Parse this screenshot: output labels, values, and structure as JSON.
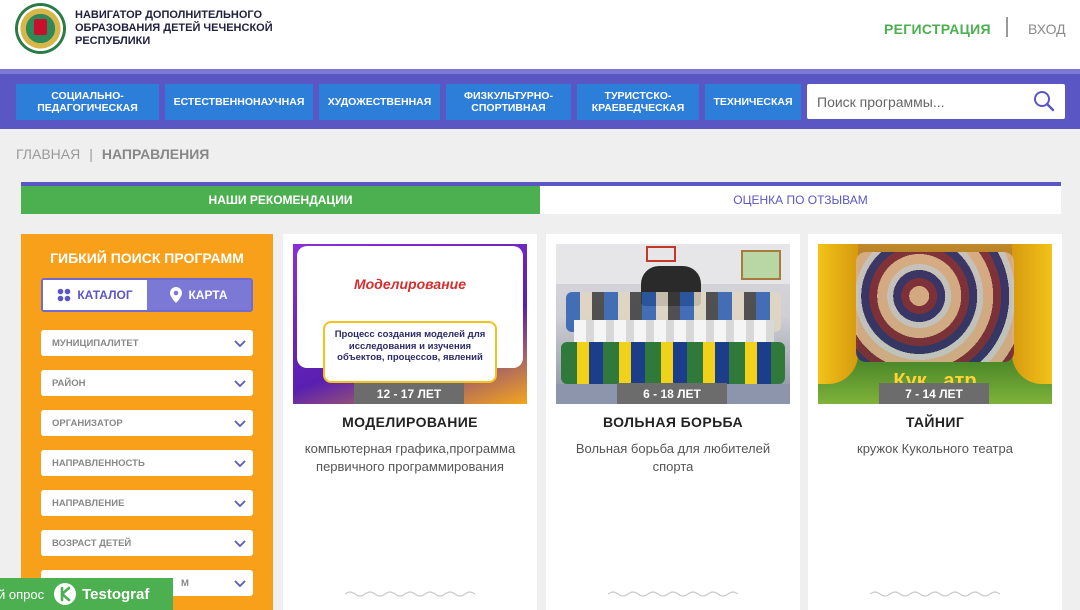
{
  "header": {
    "brand_lines": [
      "НАВИГАТОР ДОПОЛНИТЕЛЬНОГО",
      "ОБРАЗОВАНИЯ ДЕТЕЙ ЧЕЧЕНСКОЙ",
      "РЕСПУБЛИКИ"
    ],
    "register_label": "РЕГИСТРАЦИЯ",
    "login_label": "ВХОД"
  },
  "nav": {
    "items": [
      {
        "label": "СОЦИАЛЬНО-ПЕДАГОГИЧЕСКАЯ"
      },
      {
        "label": "ЕСТЕСТВЕННОНАУЧНАЯ"
      },
      {
        "label": "ХУДОЖЕСТВЕННАЯ"
      },
      {
        "label": "ФИЗКУЛЬТУРНО-СПОРТИВНАЯ"
      },
      {
        "label": "ТУРИСТСКО-КРАЕВЕДЧЕСКАЯ"
      },
      {
        "label": "ТЕХНИЧЕСКАЯ"
      }
    ],
    "search_placeholder": "Поиск программы..."
  },
  "breadcrumb": {
    "home": "ГЛАВНАЯ",
    "separator": "|",
    "current": "НАПРАВЛЕНИЯ"
  },
  "tabs": {
    "recommendations": "НАШИ РЕКОМЕНДАЦИИ",
    "reviews": "ОЦЕНКА ПО ОТЗЫВАМ"
  },
  "sidebar": {
    "title": "ГИБКИЙ ПОИСК ПРОГРАММ",
    "catalog_label": "КАТАЛОГ",
    "map_label": "КАРТА",
    "filters": [
      {
        "label": "МУНИЦИПАЛИТЕТ"
      },
      {
        "label": "РАЙОН"
      },
      {
        "label": "ОРГАНИЗАТОР"
      },
      {
        "label": "НАПРАВЛЕННОСТЬ"
      },
      {
        "label": "НАПРАВЛЕНИЕ"
      },
      {
        "label": "ВОЗРАСТ ДЕТЕЙ"
      },
      {
        "label": "М"
      }
    ]
  },
  "cards": [
    {
      "image_title": "Моделирование",
      "image_text": "Процесс создания моделей для исследования и изучения объектов, процессов, явлений",
      "age": "12 - 17 ЛЕТ",
      "title": "МОДЕЛИРОВАНИЕ",
      "description": "компьютерная графика,программа первичного программирования"
    },
    {
      "age": "6 - 18 ЛЕТ",
      "title": "ВОЛЬНАЯ БОРЬБА",
      "description": "Вольная борьба для любителей спорта"
    },
    {
      "image_text": "Кук   атр",
      "age": "7 - 14 ЛЕТ",
      "title": "ТАЙНИГ",
      "description": "кружок Кукольного театра"
    }
  ],
  "survey_badge": {
    "text": "й опрос",
    "brand": "Testograf"
  },
  "colors": {
    "nav_bg": "#5a56c4",
    "nav_button": "#2c7ed8",
    "accent_green": "#4caf50",
    "sidebar_orange": "#f9a01b"
  }
}
